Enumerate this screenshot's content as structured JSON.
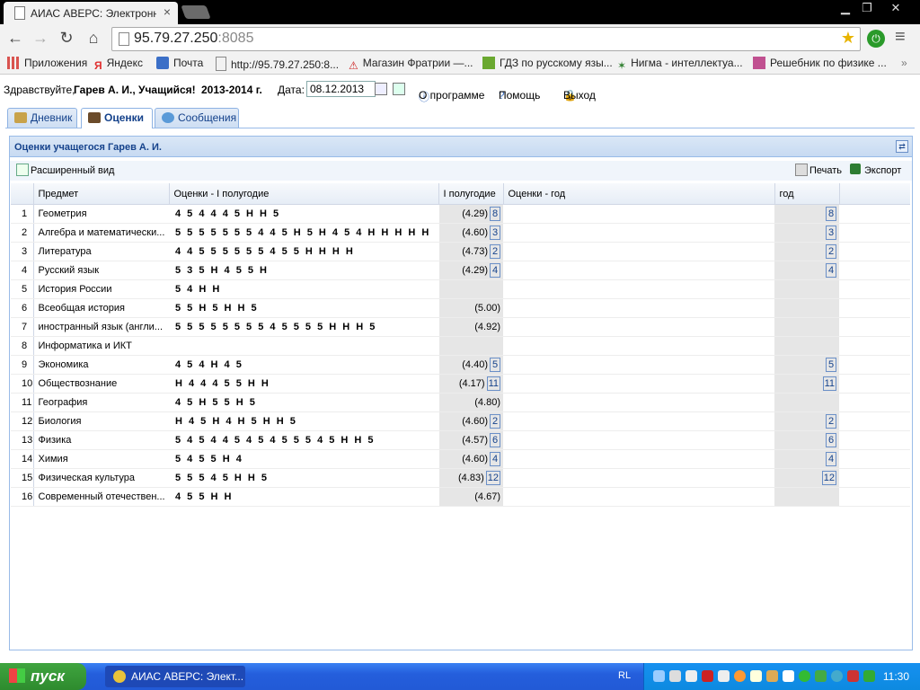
{
  "browser": {
    "tab_title": "АИАС АВЕРС: Электронный",
    "url_host": "95.79.27.250",
    "url_port": ":8085"
  },
  "bookmarks": [
    {
      "label": "Приложения",
      "icon": "apps-grid-icon",
      "color": "#d9534f"
    },
    {
      "label": "Яндекс",
      "icon": "yandex-icon",
      "color": "#e03030"
    },
    {
      "label": "Почта",
      "icon": "mail-icon",
      "color": "#3b6fc7"
    },
    {
      "label": "http://95.79.27.250:8...",
      "icon": "page-icon",
      "color": "#888888"
    },
    {
      "label": "Магазин Фратрии —...",
      "icon": "warning-icon",
      "color": "#cc2222"
    },
    {
      "label": "ГДЗ по русскому язы...",
      "icon": "gdz-icon",
      "color": "#6aa830"
    },
    {
      "label": "Нигма - интеллектуа...",
      "icon": "nigma-icon",
      "color": "#2f7f2f"
    },
    {
      "label": "Решебник по физике ...",
      "icon": "book-icon",
      "color": "#c05090"
    }
  ],
  "appbar": {
    "greeting": "Здравствуйте,",
    "user": "Гарев А. И., Учащийся!",
    "year": "2013-2014 г.",
    "date_label": "Дата:",
    "date_value": "08.12.2013",
    "about": "О программе",
    "help": "Помощь",
    "exit": "Выход"
  },
  "tabs": [
    {
      "label": "Дневник"
    },
    {
      "label": "Оценки"
    },
    {
      "label": "Сообщения"
    }
  ],
  "panel": {
    "title": "Оценки учащегося Гарев А. И.",
    "extended_view": "Расширенный вид",
    "print": "Печать",
    "export": "Экспорт"
  },
  "columns": {
    "subject": "Предмет",
    "marks_h1": "Оценки - I полугодие",
    "h1": "I полугодие",
    "marks_year": "Оценки - год",
    "year": "год"
  },
  "rows": [
    {
      "n": "1",
      "subject": "Геометрия",
      "marks": "4 5 4 4 4 5 Н Н 5",
      "avg": "(4.29)",
      "count": "8",
      "year": "8"
    },
    {
      "n": "2",
      "subject": "Алгебра и математически...",
      "marks": "5 5 5 5 5 5 5 4 4 5 Н 5 Н 4 5 4 Н Н Н Н Н",
      "avg": "(4.60)",
      "count": "3",
      "year": "3"
    },
    {
      "n": "3",
      "subject": "Литература",
      "marks": "4 4 5 5 5 5 5 5 4 5 5 Н Н Н Н",
      "avg": "(4.73)",
      "count": "2",
      "year": "2"
    },
    {
      "n": "4",
      "subject": "Русский язык",
      "marks": "5 3 5 Н 4 5 5 Н",
      "avg": "(4.29)",
      "count": "4",
      "year": "4"
    },
    {
      "n": "5",
      "subject": "История России",
      "marks": "5 4 Н Н",
      "avg": "",
      "count": "",
      "year": ""
    },
    {
      "n": "6",
      "subject": "Всеобщая история",
      "marks": "5 5 Н 5 Н Н 5",
      "avg": "(5.00)",
      "count": "",
      "year": ""
    },
    {
      "n": "7",
      "subject": "иностранный язык (англи...",
      "marks": "5 5 5 5 5 5 5 5 4 5 5 5 5 Н Н Н 5",
      "avg": "(4.92)",
      "count": "",
      "year": ""
    },
    {
      "n": "8",
      "subject": "Информатика и ИКТ",
      "marks": "",
      "avg": "",
      "count": "",
      "year": ""
    },
    {
      "n": "9",
      "subject": "Экономика",
      "marks": "4 5 4 Н 4 5",
      "avg": "(4.40)",
      "count": "5",
      "year": "5"
    },
    {
      "n": "10",
      "subject": "Обществознание",
      "marks": "Н 4 4 4 5 5 Н Н",
      "avg": "(4.17)",
      "count": "11",
      "year": "11"
    },
    {
      "n": "11",
      "subject": "География",
      "marks": "4 5 Н 5 5 Н 5",
      "avg": "(4.80)",
      "count": "",
      "year": ""
    },
    {
      "n": "12",
      "subject": "Биология",
      "marks": "Н 4 5 Н 4 Н 5 Н Н 5",
      "avg": "(4.60)",
      "count": "2",
      "year": "2"
    },
    {
      "n": "13",
      "subject": "Физика",
      "marks": "5 4 5 4 4 5 4 5 4 5 5 5 4 5 Н Н 5",
      "avg": "(4.57)",
      "count": "6",
      "year": "6"
    },
    {
      "n": "14",
      "subject": "Химия",
      "marks": "5 4 5 5 Н 4",
      "avg": "(4.60)",
      "count": "4",
      "year": "4"
    },
    {
      "n": "15",
      "subject": "Физическая культура",
      "marks": "5 5 5 4 5 Н Н 5",
      "avg": "(4.83)",
      "count": "12",
      "year": "12"
    },
    {
      "n": "16",
      "subject": "Современный отечествен...",
      "marks": "4 5 5 Н Н",
      "avg": "(4.67)",
      "count": "",
      "year": ""
    }
  ],
  "taskbar": {
    "start": "пуск",
    "window": "АИАС АВЕРС: Элект...",
    "lang": "RL",
    "clock": "11:30"
  }
}
